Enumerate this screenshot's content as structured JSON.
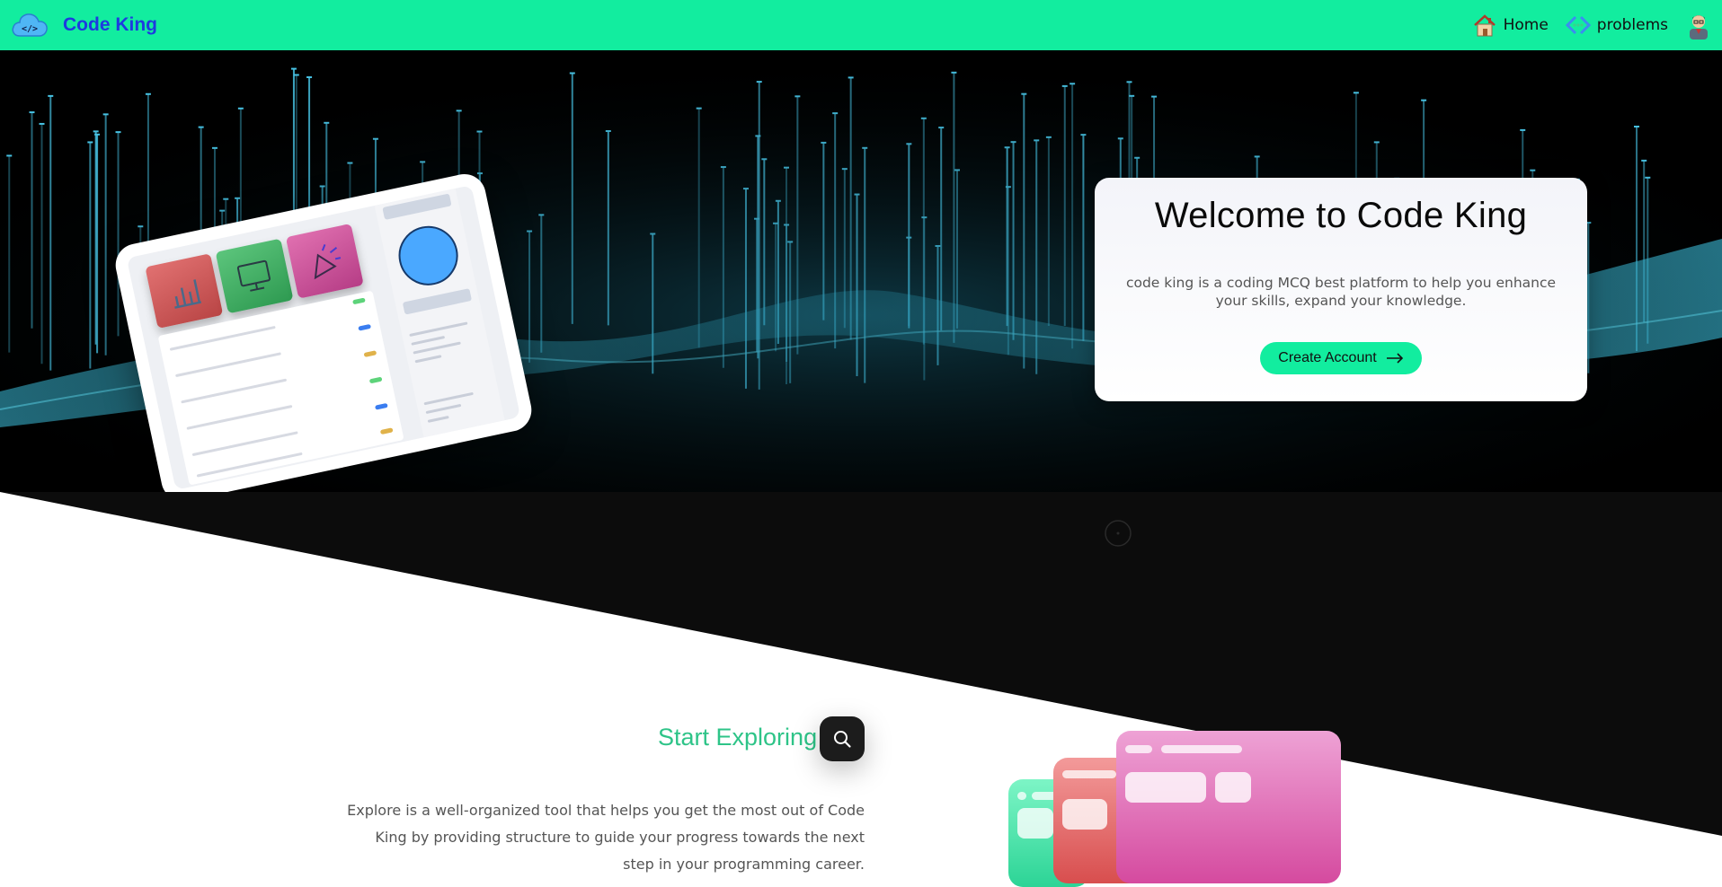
{
  "nav": {
    "brand": "Code King",
    "logo_icon": "cloud-code-icon",
    "links": [
      {
        "label": "Home",
        "icon": "house-icon"
      },
      {
        "label": "problems",
        "icon": "code-brackets-icon"
      }
    ],
    "avatar_icon": "user-avatar-icon",
    "background": "#12ed9f",
    "brand_color": "#1e3ae0"
  },
  "hero": {
    "title": "Welcome to Code King",
    "description": "code king is a coding MCQ best platform to help you enhance your skills, expand your knowledge.",
    "cta_label": "Create Account",
    "cta_icon": "arrow-right-icon",
    "accent": "#12ed9f"
  },
  "explore": {
    "title": "Start Exploring",
    "title_color": "#2ec488",
    "badge_icon": "search-icon",
    "description": "Explore is a well-organized tool that helps you get the most out of Code King by providing structure to guide your progress towards the next step in your programming career."
  }
}
